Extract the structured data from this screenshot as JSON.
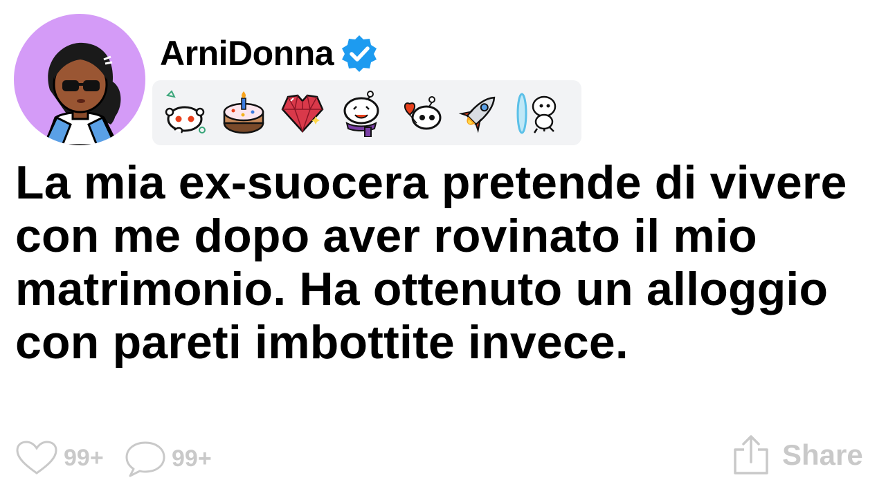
{
  "post": {
    "username": "ArniDonna",
    "verified": true,
    "title": "La mia ex-suocera pretende di vivere con me dopo aver rovinato il mio matrimonio. Ha ottenuto un alloggio con pareti imbottite invece.",
    "badges": [
      {
        "icon": "snoo-confused-icon"
      },
      {
        "icon": "cake-icon"
      },
      {
        "icon": "crystal-heart-icon"
      },
      {
        "icon": "snoo-scarf-icon"
      },
      {
        "icon": "snoo-heart-balloon-icon"
      },
      {
        "icon": "rocket-icon"
      },
      {
        "icon": "snoo-portal-icon"
      }
    ]
  },
  "actions": {
    "likes": "99+",
    "comments": "99+",
    "share_label": "Share"
  },
  "colors": {
    "avatar_bg": "#d49bf7",
    "verified_blue": "#1d9bf0",
    "badge_bg": "#f2f3f5",
    "action_gray": "#c9c9c9",
    "text": "#000000"
  }
}
